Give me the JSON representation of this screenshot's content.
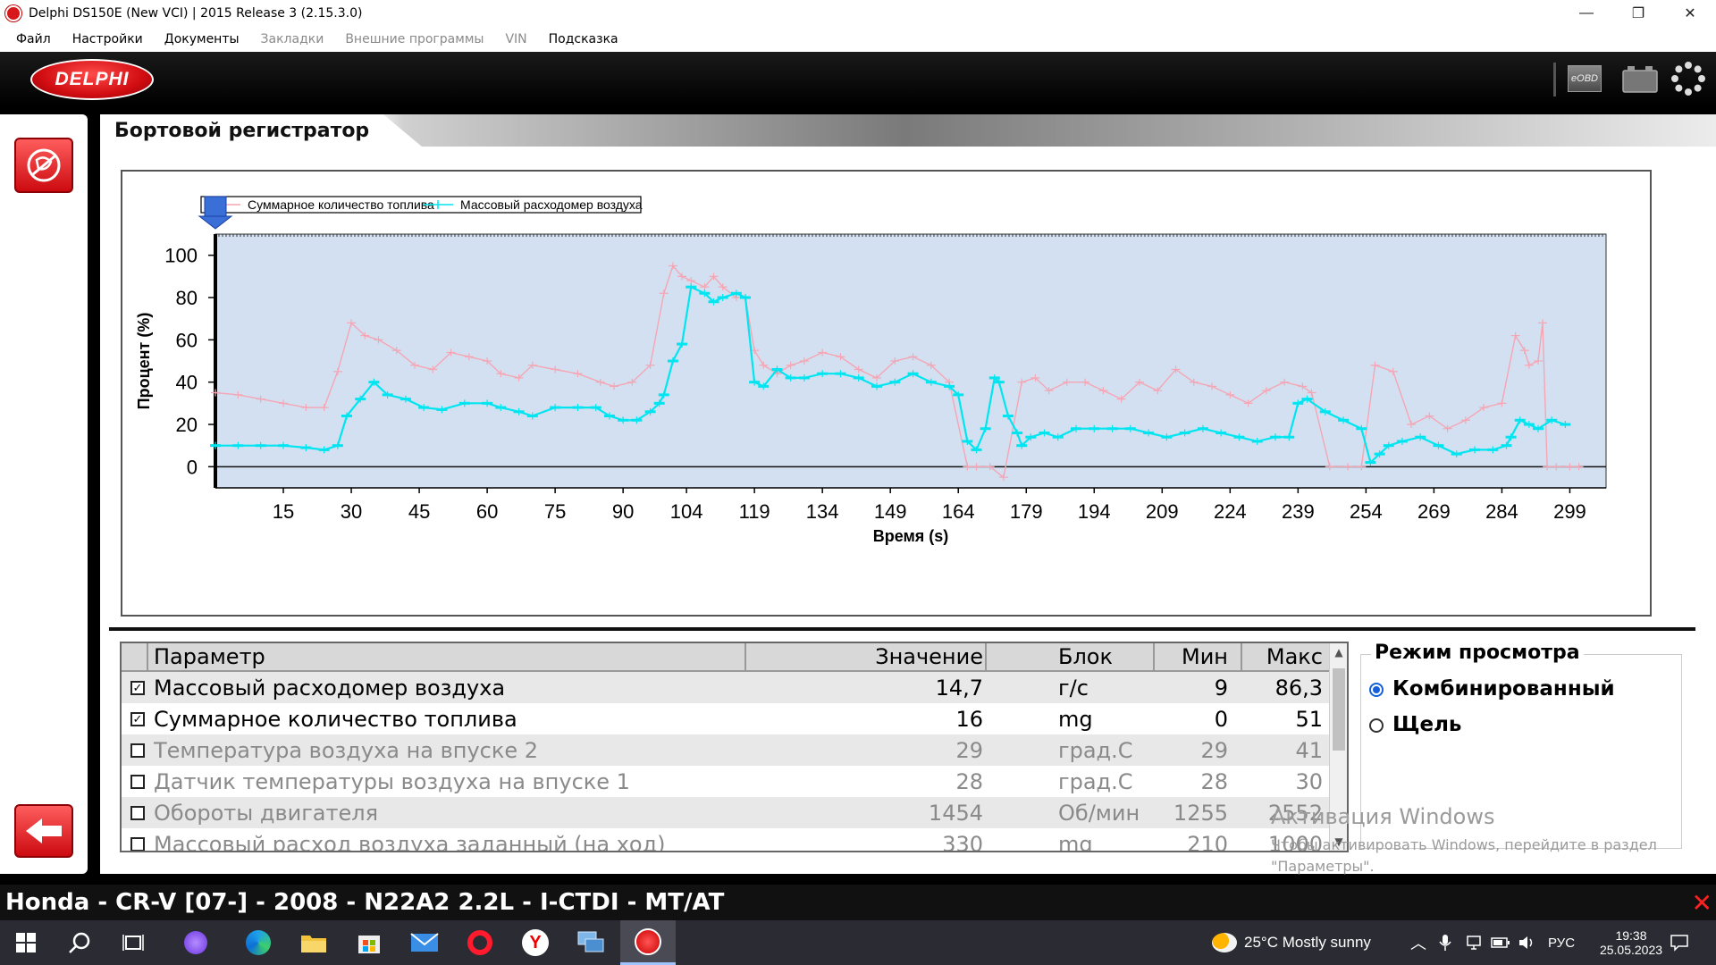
{
  "window": {
    "title": "Delphi DS150E (New VCI) | 2015 Release 3 (2.15.3.0)",
    "controls": {
      "minimize": "—",
      "maximize": "❐",
      "close": "✕"
    }
  },
  "menu": [
    {
      "label": "Файл",
      "enabled": true
    },
    {
      "label": "Настройки",
      "enabled": true
    },
    {
      "label": "Документы",
      "enabled": true
    },
    {
      "label": "Закладки",
      "enabled": false
    },
    {
      "label": "Внешние программы",
      "enabled": false
    },
    {
      "label": "VIN",
      "enabled": false
    },
    {
      "label": "Подсказка",
      "enabled": true
    }
  ],
  "header": {
    "logo_text": "DELPHI",
    "eobd_label": "eOBD",
    "icons": [
      "eobd-icon",
      "battery-icon",
      "spinner-icon"
    ]
  },
  "sidebar": {
    "icons": [
      "diagnostic-icon",
      "back-arrow-icon"
    ]
  },
  "page": {
    "title": "Бортовой регистратор"
  },
  "colors": {
    "series_fuel": "#f4a6b4",
    "series_maf": "#00e5f0",
    "plot_bg": "#d3e0f1",
    "accent_red": "#d8171c"
  },
  "chart_data": {
    "type": "line",
    "xlabel": "Время (s)",
    "ylabel": "Процент (%)",
    "ylim": [
      -10,
      110
    ],
    "xlim": [
      0,
      307
    ],
    "x_ticks": [
      15,
      30,
      45,
      60,
      75,
      90,
      104,
      119,
      134,
      149,
      164,
      179,
      194,
      209,
      224,
      239,
      254,
      269,
      284,
      299
    ],
    "y_ticks": [
      0,
      20,
      40,
      60,
      80,
      100
    ],
    "grid": false,
    "legend_position": "top-left",
    "series": [
      {
        "name": "Суммарное количество топлива",
        "color": "#f4a6b4",
        "x": [
          0,
          5,
          10,
          15,
          20,
          24,
          27,
          30,
          33,
          36,
          40,
          44,
          48,
          52,
          56,
          60,
          63,
          67,
          70,
          75,
          80,
          85,
          88,
          92,
          96,
          99,
          101,
          103,
          105,
          108,
          110,
          112,
          115,
          117,
          119,
          121,
          124,
          127,
          130,
          134,
          138,
          142,
          146,
          150,
          154,
          158,
          162,
          166,
          168,
          171,
          174,
          178,
          181,
          184,
          188,
          192,
          196,
          200,
          204,
          208,
          212,
          216,
          220,
          224,
          228,
          232,
          236,
          240,
          242,
          246,
          250,
          253,
          256,
          260,
          264,
          268,
          272,
          276,
          280,
          284,
          287,
          289,
          290,
          292,
          293,
          294,
          296,
          299,
          301
        ],
        "y": [
          35,
          34,
          32,
          30,
          28,
          28,
          45,
          68,
          62,
          60,
          55,
          48,
          46,
          54,
          52,
          50,
          44,
          42,
          48,
          46,
          44,
          40,
          38,
          40,
          48,
          82,
          95,
          90,
          88,
          85,
          90,
          85,
          80,
          80,
          55,
          48,
          44,
          48,
          50,
          54,
          52,
          46,
          42,
          50,
          52,
          48,
          40,
          0,
          0,
          0,
          -5,
          40,
          42,
          36,
          40,
          40,
          36,
          32,
          40,
          36,
          46,
          40,
          38,
          34,
          30,
          36,
          40,
          38,
          35,
          0,
          0,
          0,
          48,
          45,
          20,
          24,
          18,
          22,
          28,
          30,
          62,
          55,
          48,
          50,
          68,
          0,
          0,
          0,
          0
        ]
      },
      {
        "name": "Массовый расходомер воздуха",
        "color": "#00e5f0",
        "x": [
          0,
          5,
          10,
          15,
          20,
          24,
          27,
          29,
          32,
          35,
          38,
          42,
          46,
          50,
          55,
          60,
          63,
          67,
          70,
          75,
          80,
          84,
          87,
          90,
          93,
          96,
          98,
          99,
          101,
          103,
          105,
          108,
          110,
          112,
          115,
          117,
          119,
          121,
          124,
          127,
          130,
          134,
          138,
          142,
          146,
          150,
          154,
          158,
          162,
          164,
          166,
          168,
          170,
          172,
          173,
          175,
          177,
          178,
          180,
          183,
          186,
          190,
          194,
          198,
          202,
          206,
          210,
          214,
          218,
          222,
          226,
          230,
          234,
          237,
          239,
          241,
          245,
          249,
          253,
          255,
          257,
          259,
          262,
          266,
          270,
          274,
          278,
          282,
          285,
          286,
          288,
          290,
          292,
          295,
          298
        ],
        "y": [
          10,
          10,
          10,
          10,
          9,
          8,
          10,
          24,
          32,
          40,
          34,
          32,
          28,
          27,
          30,
          30,
          28,
          26,
          24,
          28,
          28,
          28,
          24,
          22,
          22,
          26,
          30,
          34,
          50,
          58,
          85,
          82,
          78,
          80,
          82,
          80,
          40,
          38,
          46,
          42,
          42,
          44,
          44,
          42,
          38,
          40,
          44,
          40,
          38,
          34,
          12,
          8,
          18,
          42,
          40,
          24,
          16,
          10,
          14,
          16,
          14,
          18,
          18,
          18,
          18,
          16,
          14,
          16,
          18,
          16,
          14,
          12,
          14,
          14,
          30,
          32,
          26,
          22,
          18,
          2,
          6,
          10,
          12,
          14,
          10,
          6,
          8,
          8,
          10,
          14,
          22,
          20,
          18,
          22,
          20
        ]
      }
    ]
  },
  "table": {
    "columns": [
      "Параметр",
      "Значение",
      "Блок",
      "Мин",
      "Макс"
    ],
    "rows": [
      {
        "checked": true,
        "active": true,
        "param": "Массовый расходомер воздуха",
        "value": "14,7",
        "unit": "г/с",
        "min": "9",
        "max": "86,3"
      },
      {
        "checked": true,
        "active": true,
        "param": "Суммарное количество топлива",
        "value": "16",
        "unit": "mg",
        "min": "0",
        "max": "51"
      },
      {
        "checked": false,
        "active": false,
        "param": "Температура воздуха на впуске 2",
        "value": "29",
        "unit": "град.С",
        "min": "29",
        "max": "41"
      },
      {
        "checked": false,
        "active": false,
        "param": "Датчик температуры воздуха на впуске 1",
        "value": "28",
        "unit": "град.С",
        "min": "28",
        "max": "30"
      },
      {
        "checked": false,
        "active": false,
        "param": "Обороты двигателя",
        "value": "1454",
        "unit": "Об/мин",
        "min": "1255",
        "max": "2552"
      },
      {
        "checked": false,
        "active": false,
        "param": "Массовый расход воздуха заданный (на ход)",
        "value": "330",
        "unit": "mg",
        "min": "210",
        "max": "1000"
      }
    ]
  },
  "view_mode": {
    "title": "Режим просмотра",
    "options": [
      {
        "label": "Комбинированный",
        "selected": true
      },
      {
        "label": "Щель",
        "selected": false
      }
    ]
  },
  "watermark": {
    "line1": "Активация Windows",
    "line2": "Чтобы активировать Windows, перейдите в раздел",
    "line3": "\"Параметры\"."
  },
  "vehicle": {
    "label": "Honda - CR-V [07-] - 2008 - N22A2 2.2L - I-CTDI - MT/AT",
    "close": "✕"
  },
  "taskbar": {
    "apps": [
      "start-icon",
      "search-icon",
      "task-view-icon",
      "cortana-icon",
      "edge-icon",
      "explorer-icon",
      "store-icon",
      "mail-icon",
      "opera-icon",
      "yandex-icon",
      "network-app-icon",
      "delphi-app-icon"
    ],
    "weather": "25°C  Mostly sunny",
    "language": "РУС",
    "time": "19:38",
    "date": "25.05.2023"
  }
}
